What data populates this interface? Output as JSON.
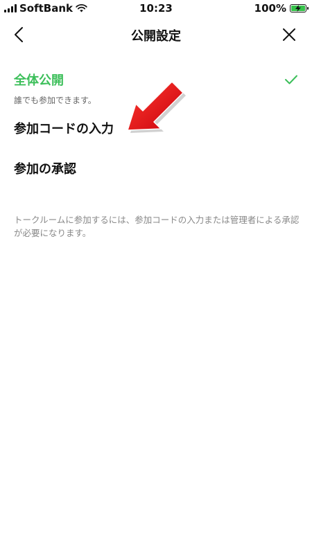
{
  "status_bar": {
    "carrier": "SoftBank",
    "time": "10:23",
    "battery": "100%"
  },
  "header": {
    "title": "公開設定"
  },
  "options": [
    {
      "label": "全体公開",
      "description": "誰でも参加できます。",
      "selected": true
    },
    {
      "label": "参加コードの入力",
      "selected": false
    },
    {
      "label": "参加の承認",
      "selected": false
    }
  ],
  "note": "トークルームに参加するには、参加コードの入力または管理者による承認が必要になります。",
  "colors": {
    "accent_green": "#3cbf5a",
    "annotation_red": "#e60012",
    "text_primary": "#111111",
    "text_secondary": "#666666",
    "text_note": "#888888"
  },
  "icons": {
    "back": "chevron-left-icon",
    "close": "close-icon",
    "check": "checkmark-icon",
    "signal": "cellular-signal-icon",
    "wifi": "wifi-icon",
    "battery": "battery-charging-icon"
  }
}
